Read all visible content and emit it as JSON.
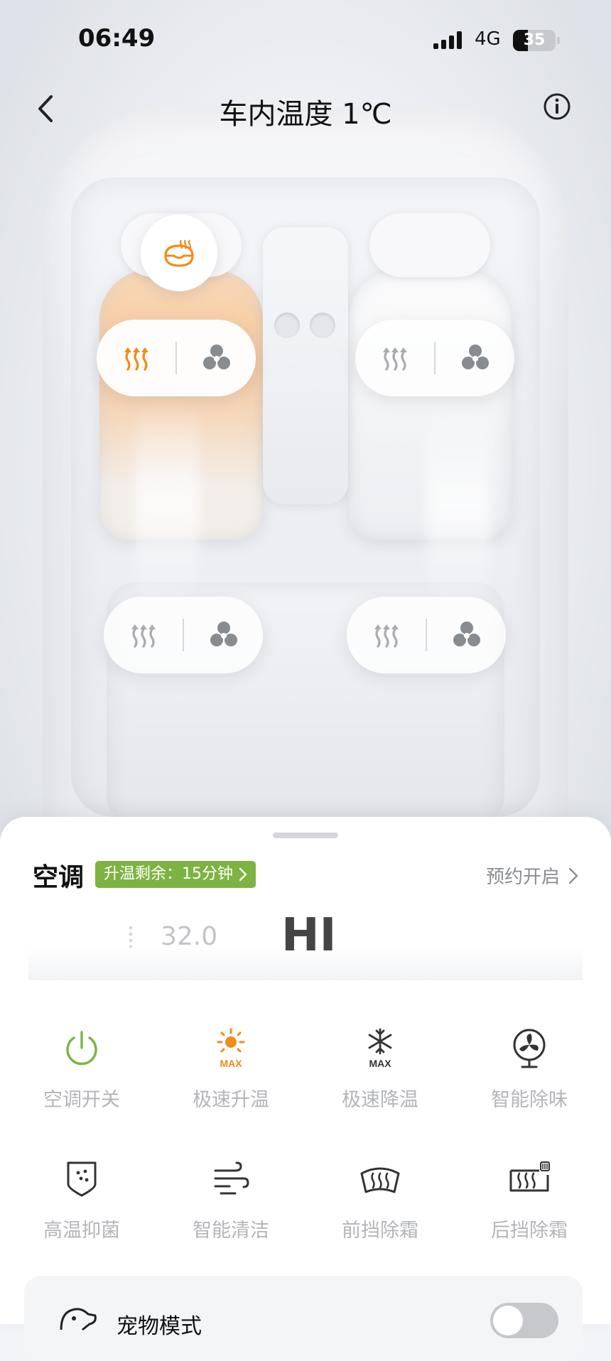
{
  "status_bar": {
    "time": "06:49",
    "network": "4G",
    "battery_level": "35"
  },
  "nav": {
    "title": "车内温度 1℃",
    "back_icon": "chevron-left-icon",
    "info_icon": "info-icon"
  },
  "seats": {
    "steering_wheel_heat": {
      "icon": "steering-wheel-heat-icon",
      "active": true
    },
    "front_left": {
      "heat_active": true,
      "vent_active": false
    },
    "front_right": {
      "heat_active": false,
      "vent_active": false
    },
    "rear_left": {
      "heat_active": false,
      "vent_active": false
    },
    "rear_right": {
      "heat_active": false,
      "vent_active": false
    }
  },
  "ac": {
    "title": "空调",
    "badge": "升温剩余：15分钟",
    "schedule": "预约开启",
    "temp_side": "32.0",
    "temp_current": "HI"
  },
  "functions": [
    {
      "label": "空调开关",
      "icon": "power-icon"
    },
    {
      "label": "极速升温",
      "icon": "sun-max-icon",
      "icon_text": "MAX"
    },
    {
      "label": "极速降温",
      "icon": "snowflake-max-icon",
      "icon_text": "MAX"
    },
    {
      "label": "智能除味",
      "icon": "fan-deodorize-icon"
    },
    {
      "label": "高温抑菌",
      "icon": "shield-bacteria-icon"
    },
    {
      "label": "智能清洁",
      "icon": "wind-clean-icon"
    },
    {
      "label": "前挡除霜",
      "icon": "front-defrost-icon"
    },
    {
      "label": "后挡除霜",
      "icon": "rear-defrost-icon"
    }
  ],
  "pet_mode": {
    "label": "宠物模式",
    "enabled": false
  },
  "colors": {
    "accent_orange": "#f08c1a",
    "active_green": "#7cb342",
    "icon_dark": "#333333",
    "icon_muted": "#a9abaf"
  }
}
